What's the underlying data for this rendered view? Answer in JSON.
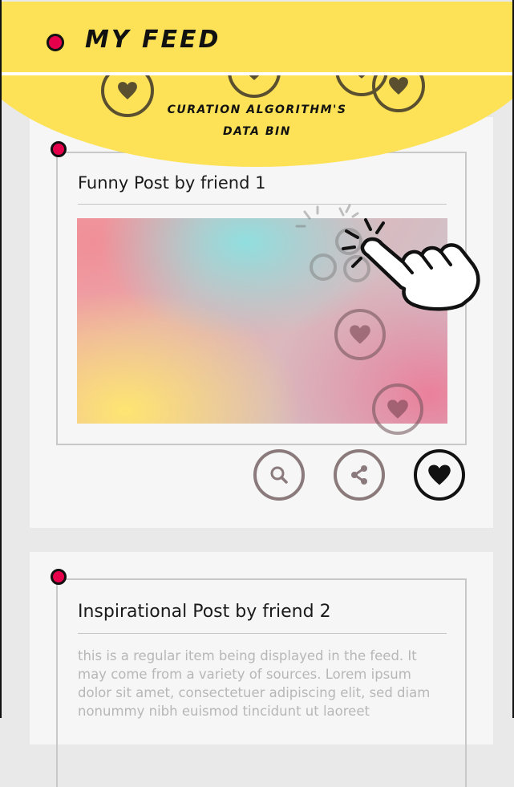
{
  "header": {
    "title": "MY FEED"
  },
  "bin": {
    "line1": "CURATION ALGORITHM'S",
    "line2": "DATA BIN"
  },
  "posts": [
    {
      "title": "Funny Post by friend 1"
    },
    {
      "title": "Inspirational Post by friend 2",
      "body": "this is a regular item being displayed in the feed. It may come from a variety of sources. Lorem ipsum dolor sit amet, consectetuer adipiscing elit, sed diam nonummy nibh euismod tincidunt ut laoreet"
    }
  ],
  "icons": {
    "search": "search-icon",
    "share": "share-icon",
    "like": "heart-icon",
    "accent": "#e6004c",
    "header_bg": "#fde257"
  }
}
